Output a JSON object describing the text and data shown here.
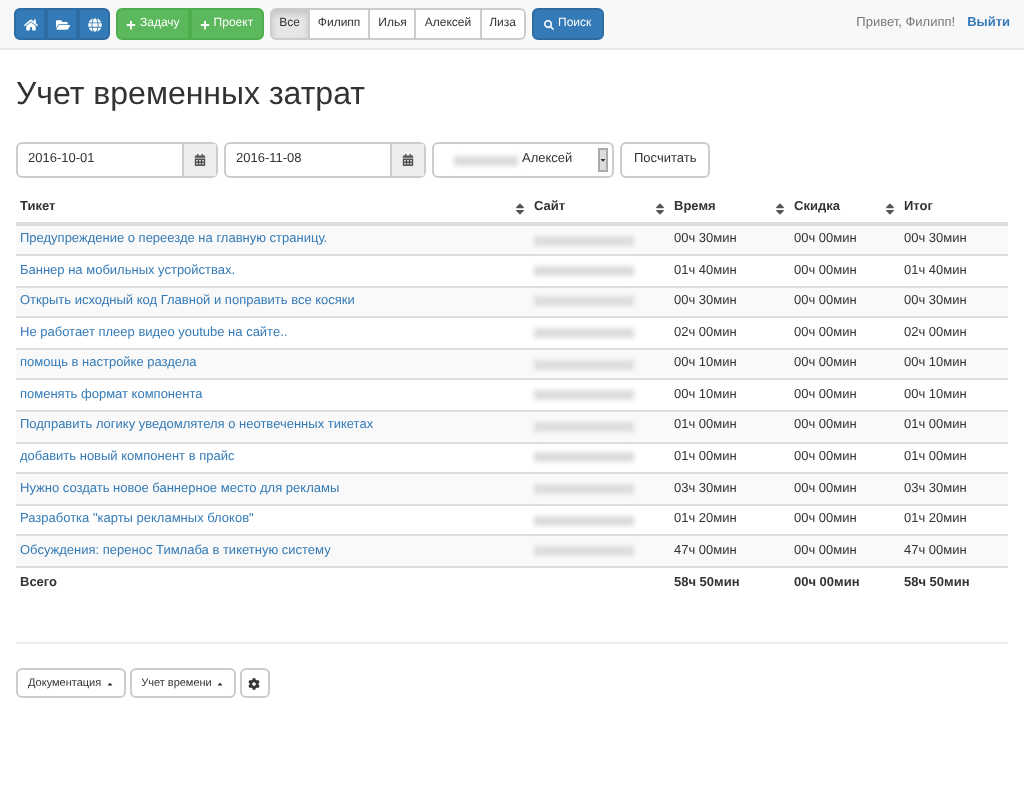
{
  "navbar": {
    "icon_buttons": [
      {
        "kind": "home"
      },
      {
        "kind": "folder"
      },
      {
        "kind": "globe"
      }
    ],
    "add_buttons": [
      "Задачу",
      "Проект"
    ],
    "filters": [
      {
        "label": "Все",
        "selected": true
      },
      {
        "label": "Филипп",
        "selected": false
      },
      {
        "label": "Илья",
        "selected": false
      },
      {
        "label": "Алексей",
        "selected": false
      },
      {
        "label": "Лиза",
        "selected": false
      }
    ],
    "search_button": "Поиск",
    "greeting": "Привет, Филипп!",
    "logout": "Выйти"
  },
  "title": "Учет временных затрат",
  "form": {
    "date_from": "2016-10-01",
    "date_to": "2016-11-08",
    "user": "Алексей",
    "submit": "Посчитать"
  },
  "table": {
    "columns": [
      {
        "label": "Тикет",
        "sortable": true
      },
      {
        "label": "Сайт",
        "sortable": true
      },
      {
        "label": "Время",
        "sortable": true
      },
      {
        "label": "Скидка",
        "sortable": true
      },
      {
        "label": "Итог",
        "sortable": false
      }
    ],
    "rows": [
      {
        "ticket": "Предупреждение о переезде на главную страницу.",
        "time": "00ч 30мин",
        "discount": "00ч 00мин",
        "total": "00ч 30мин"
      },
      {
        "ticket": "Баннер на мобильных устройствах.",
        "time": "01ч 40мин",
        "discount": "00ч 00мин",
        "total": "01ч 40мин"
      },
      {
        "ticket": "Открыть исходный код Главной и поправить все косяки",
        "time": "00ч 30мин",
        "discount": "00ч 00мин",
        "total": "00ч 30мин"
      },
      {
        "ticket": "Не работает плеер видео youtube на сайте..",
        "time": "02ч 00мин",
        "discount": "00ч 00мин",
        "total": "02ч 00мин"
      },
      {
        "ticket": "помощь в настройке раздела",
        "time": "00ч 10мин",
        "discount": "00ч 00мин",
        "total": "00ч 10мин"
      },
      {
        "ticket": "поменять формат компонента",
        "time": "00ч 10мин",
        "discount": "00ч 00мин",
        "total": "00ч 10мин"
      },
      {
        "ticket": "Подправить логику уведомлятеля о неотвеченных тикетах",
        "time": "01ч 00мин",
        "discount": "00ч 00мин",
        "total": "01ч 00мин"
      },
      {
        "ticket": "добавить новый компонент в прайс",
        "time": "01ч 00мин",
        "discount": "00ч 00мин",
        "total": "01ч 00мин"
      },
      {
        "ticket": "Нужно создать новое баннерное место для рекламы",
        "time": "03ч 30мин",
        "discount": "00ч 00мин",
        "total": "03ч 30мин"
      },
      {
        "ticket": "Разработка \"карты рекламных блоков\"",
        "time": "01ч 20мин",
        "discount": "00ч 00мин",
        "total": "01ч 20мин"
      },
      {
        "ticket": "Обсуждения: перенос Тимлаба в тикетную систему",
        "time": "47ч 00мин",
        "discount": "00ч 00мин",
        "total": "47ч 00мин"
      }
    ],
    "footer": {
      "label": "Всего",
      "time": "58ч 50мин",
      "discount": "00ч 00мин",
      "total": "58ч 50мин"
    }
  },
  "bottom_buttons": [
    {
      "kind": "dropdown",
      "label": "Документация"
    },
    {
      "kind": "dropdown",
      "label": "Учет времени"
    },
    {
      "kind": "gear"
    }
  ]
}
